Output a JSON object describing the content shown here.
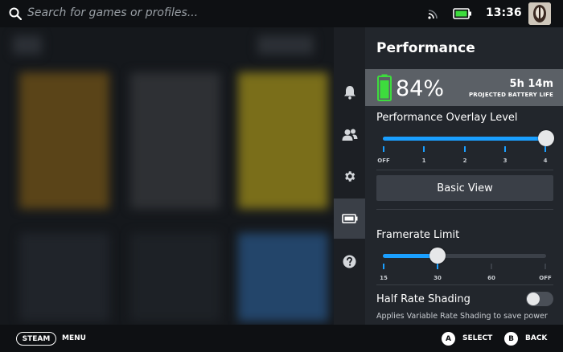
{
  "topbar": {
    "search_placeholder": "Search for games or profiles...",
    "time": "13:36",
    "icons": [
      "search-icon",
      "wifi-icon",
      "battery-icon",
      "avatar"
    ]
  },
  "sidenav": {
    "items": [
      {
        "name": "notifications",
        "icon": "bell-icon"
      },
      {
        "name": "friends",
        "icon": "friends-icon"
      },
      {
        "name": "settings",
        "icon": "gear-icon"
      },
      {
        "name": "performance",
        "icon": "battery-icon",
        "active": true
      },
      {
        "name": "help",
        "icon": "help-icon"
      }
    ]
  },
  "panel": {
    "title": "Performance",
    "battery": {
      "percent_label": "84%",
      "percent": 84,
      "time_left": "5h 14m",
      "subtitle": "PROJECTED BATTERY LIFE"
    },
    "overlay": {
      "label": "Performance Overlay Level",
      "ticks": [
        "OFF",
        "1",
        "2",
        "3",
        "4"
      ],
      "value_index": 4
    },
    "basic_view_label": "Basic View",
    "framerate": {
      "label": "Framerate Limit",
      "ticks": [
        "15",
        "30",
        "60",
        "OFF"
      ],
      "value_index": 1
    },
    "half_rate": {
      "label": "Half Rate Shading",
      "enabled": false,
      "description": "Applies Variable Rate Shading to save power"
    }
  },
  "bottombar": {
    "steam_label": "STEAM",
    "menu_label": "MENU",
    "a_button": "A",
    "a_label": "SELECT",
    "b_button": "B",
    "b_label": "BACK"
  },
  "colors": {
    "accent": "#1a9fff",
    "battery_green": "#3ddc3d",
    "panel_bg": "#22262c"
  }
}
